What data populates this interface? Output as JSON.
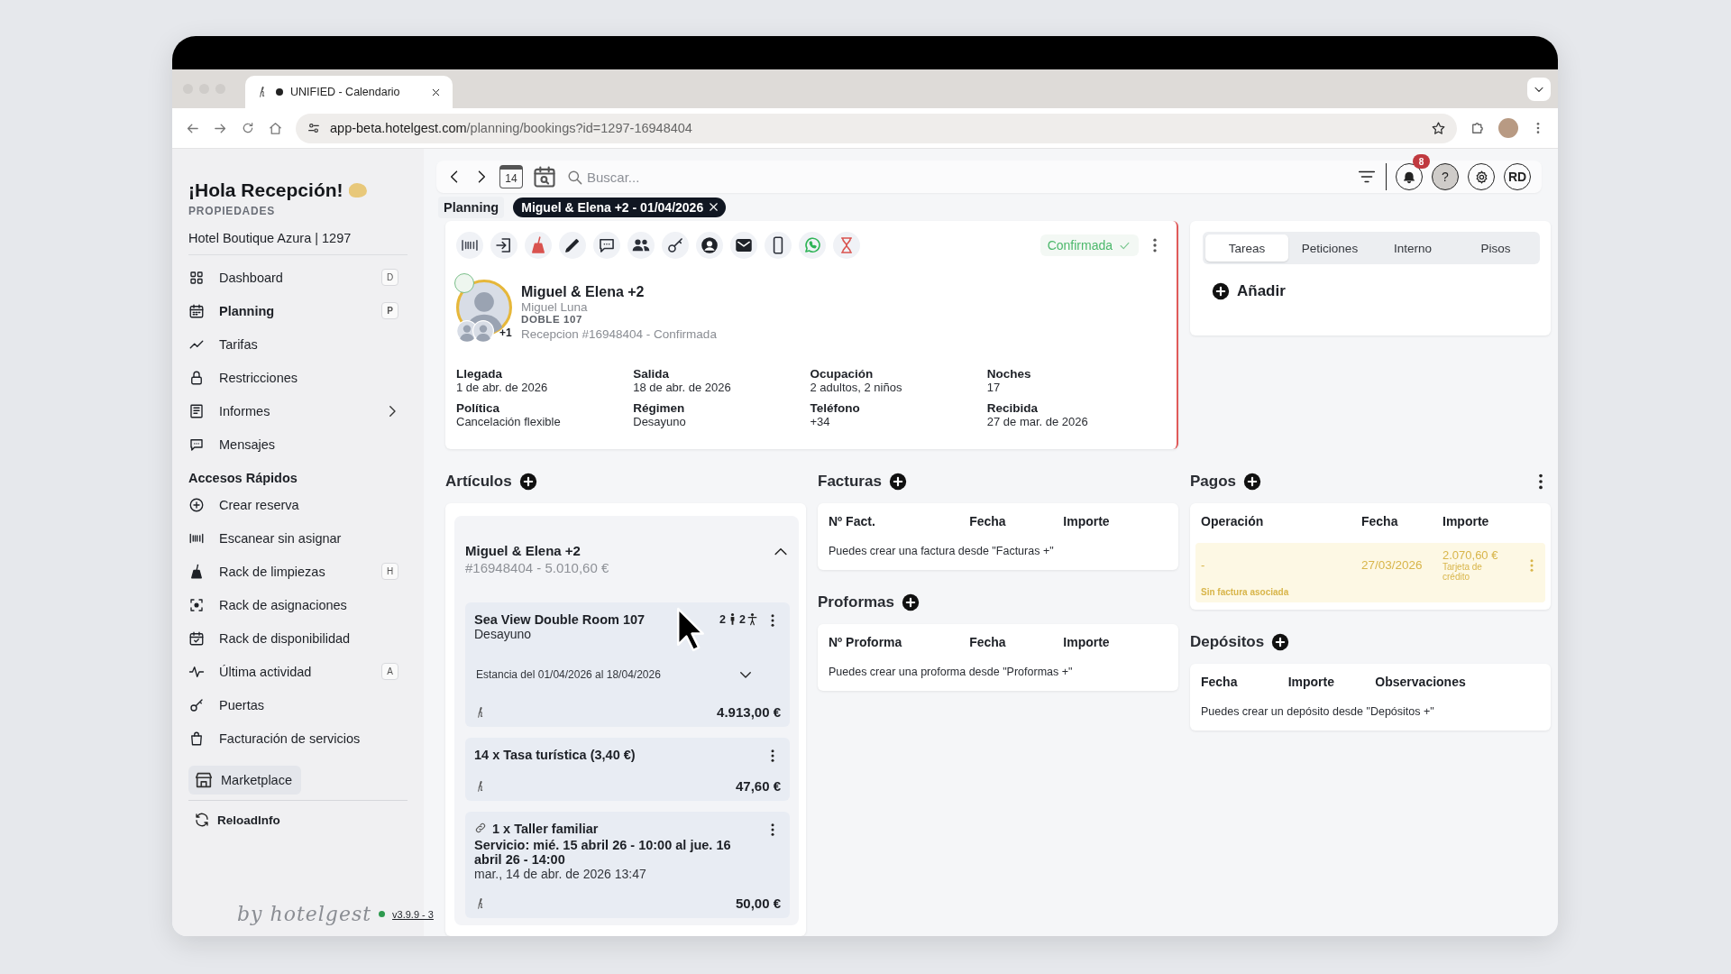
{
  "browser": {
    "tab_title": "UNIFIED - Calendario",
    "url_host": "app-beta.hotelgest.com",
    "url_path": "/planning/bookings?id=1297-16948404"
  },
  "sidebar": {
    "greeting": "¡Hola Recepción!",
    "section_label": "PROPIEDADES",
    "property": "Hotel Boutique Azura | 1297",
    "items": [
      {
        "label": "Dashboard",
        "shortcut": "D",
        "selected": false,
        "submenu": false
      },
      {
        "label": "Planning",
        "shortcut": "P",
        "selected": true,
        "submenu": false
      },
      {
        "label": "Tarifas",
        "selected": false,
        "submenu": false
      },
      {
        "label": "Restricciones",
        "selected": false,
        "submenu": false
      },
      {
        "label": "Informes",
        "selected": false,
        "submenu": true
      },
      {
        "label": "Mensajes",
        "selected": false,
        "submenu": false
      }
    ],
    "quick_title": "Accesos Rápidos",
    "quick_items": [
      {
        "label": "Crear reserva"
      },
      {
        "label": "Escanear sin asignar"
      },
      {
        "label": "Rack de limpiezas",
        "shortcut": "H"
      },
      {
        "label": "Rack de asignaciones"
      },
      {
        "label": "Rack de disponibilidad"
      },
      {
        "label": "Última actividad",
        "shortcut": "A"
      },
      {
        "label": "Puertas"
      },
      {
        "label": "Facturación de servicios"
      }
    ],
    "marketplace": "Marketplace",
    "reload": "ReloadInfo",
    "brand": "by hotelgest",
    "version": "v3.9.9 - 3"
  },
  "toolbar": {
    "today": "14",
    "search_placeholder": "Buscar...",
    "notifications": "8",
    "help": "?",
    "user_initials": "RD"
  },
  "breadcrumb": {
    "label": "Planning",
    "chip": "Miguel & Elena +2 - 01/04/2026"
  },
  "booking": {
    "status": "Confirmada",
    "name": "Miguel & Elena +2",
    "holder": "Miguel Luna",
    "room": "DOBLE 107",
    "extra_guests": "+1",
    "reference": "Recepcion #16948404 - Confirmada",
    "details": [
      {
        "label": "Llegada",
        "value": "1 de abr. de 2026"
      },
      {
        "label": "Salida",
        "value": "18 de abr. de 2026"
      },
      {
        "label": "Ocupación",
        "value": "2 adultos, 2 niños"
      },
      {
        "label": "Noches",
        "value": "17"
      },
      {
        "label": "Política",
        "value": "Cancelación flexible"
      },
      {
        "label": "Régimen",
        "value": "Desayuno"
      },
      {
        "label": "Teléfono",
        "value": "+34"
      },
      {
        "label": "Recibida",
        "value": "27 de mar. de 2026"
      }
    ]
  },
  "tasks": {
    "tabs": [
      {
        "label": "Tareas",
        "selected": true
      },
      {
        "label": "Peticiones",
        "selected": false
      },
      {
        "label": "Interno",
        "selected": false
      },
      {
        "label": "Pisos",
        "selected": false
      }
    ],
    "add": "Añadir"
  },
  "articles": {
    "title": "Artículos",
    "group": {
      "name": "Miguel & Elena +2",
      "summary": "#16948404 - 5.010,60 €",
      "expanded": true
    },
    "items": [
      {
        "kind": "room",
        "title": "Sea View Double Room 107",
        "subtitle": "Desayuno",
        "adults": "2",
        "children": "2",
        "stay": "Estancia del 01/04/2026 al 18/04/2026",
        "stay_expanded": false,
        "price": "4.913,00 €"
      },
      {
        "kind": "fee",
        "title": "14 x Tasa turística (3,40 €)",
        "price": "47,60 €"
      },
      {
        "kind": "service",
        "title": "1 x Taller familiar",
        "detail": "Servicio: mié. 15 abril 26 - 10:00 al jue. 16 abril 26 - 14:00",
        "date": "mar., 14 de abr. de 2026 13:47",
        "price": "50,00 €"
      }
    ]
  },
  "invoices": {
    "title": "Facturas",
    "columns": [
      "Nº Fact.",
      "Fecha",
      "Importe"
    ],
    "empty": "Puedes crear una factura desde \"Facturas +\""
  },
  "proformas": {
    "title": "Proformas",
    "columns": [
      "Nº Proforma",
      "Fecha",
      "Importe"
    ],
    "empty": "Puedes crear una proforma desde \"Proformas +\""
  },
  "payments": {
    "title": "Pagos",
    "columns": [
      "Operación",
      "Fecha",
      "Importe"
    ],
    "rows": [
      {
        "operation": "-",
        "date": "27/03/2026",
        "amount": "2.070,60 €",
        "method": "Tarjeta de crédito",
        "note": "Sin factura asociada",
        "pending": true
      }
    ]
  },
  "deposits": {
    "title": "Depósitos",
    "columns": [
      "Fecha",
      "Importe",
      "Observaciones"
    ],
    "empty": "Puedes crear un depósito desde \"Depósitos +\""
  }
}
